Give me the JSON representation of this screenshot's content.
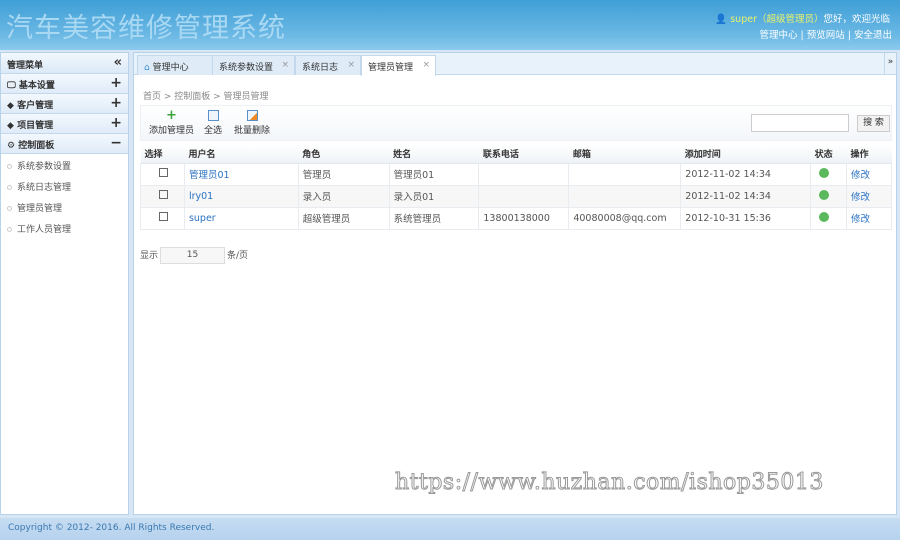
{
  "header": {
    "title": "汽车美容维修管理系统",
    "user": "super（超级管理员）",
    "greeting": "您好，欢迎光临",
    "links": [
      "管理中心",
      "预览网站",
      "安全退出"
    ]
  },
  "sidebar": {
    "title": "管理菜单",
    "collapse": "«",
    "groups": [
      {
        "label": "基本设置",
        "toggle": "+"
      },
      {
        "label": "客户管理",
        "toggle": "+"
      },
      {
        "label": "项目管理",
        "toggle": "+"
      },
      {
        "label": "控制面板",
        "toggle": "−"
      }
    ],
    "items": [
      "系统参数设置",
      "系统日志管理",
      "管理员管理",
      "工作人员管理"
    ]
  },
  "tabs": [
    {
      "label": "管理中心"
    },
    {
      "label": "系统参数设置",
      "close": "×"
    },
    {
      "label": "系统日志",
      "close": "×"
    },
    {
      "label": "管理员管理",
      "close": "×"
    }
  ],
  "tab_more": "»",
  "breadcrumb": "首页 > 控制面板 > 管理员管理",
  "toolbar": {
    "add": "添加管理员",
    "select_all": "全选",
    "batch_delete": "批量删除",
    "search_placeholder": "",
    "search": "搜 索"
  },
  "table": {
    "headers": [
      "选择",
      "用户名",
      "角色",
      "姓名",
      "联系电话",
      "邮箱",
      "添加时间",
      "状态",
      "操作"
    ],
    "rows": [
      {
        "username": "管理员01",
        "role": "管理员",
        "name": "管理员01",
        "phone": "",
        "email": "",
        "time": "2012-11-02 14:34",
        "action": "修改"
      },
      {
        "username": "lry01",
        "role": "录入员",
        "name": "录入员01",
        "phone": "",
        "email": "",
        "time": "2012-11-02 14:34",
        "action": "修改"
      },
      {
        "username": "super",
        "role": "超级管理员",
        "name": "系统管理员",
        "phone": "13800138000",
        "email": "40080008@qq.com",
        "time": "2012-10-31 15:36",
        "action": "修改"
      }
    ]
  },
  "pager": {
    "show": "显示",
    "per_page": "15",
    "unit": "条/页"
  },
  "watermark": "https://www.huzhan.com/ishop35013",
  "footer": "Copyright © 2012- 2016. All Rights Reserved."
}
